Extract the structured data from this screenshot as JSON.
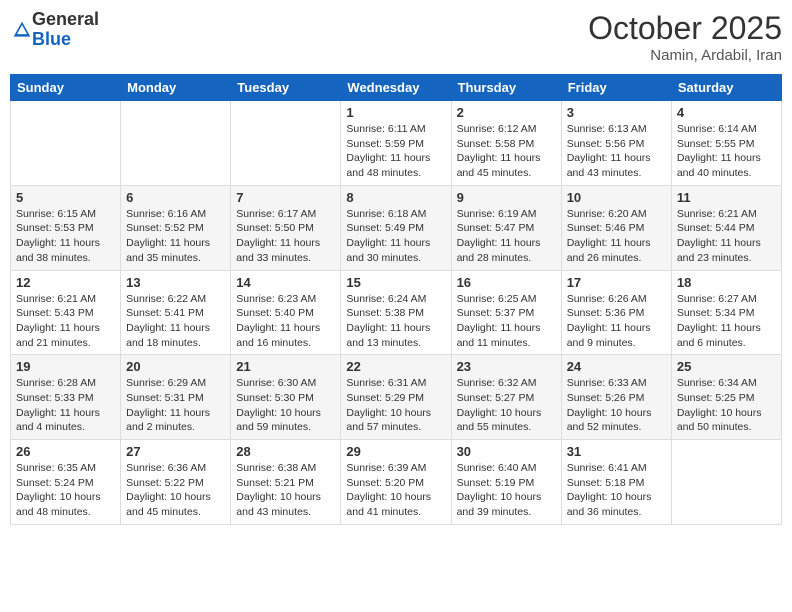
{
  "logo": {
    "general": "General",
    "blue": "Blue"
  },
  "header": {
    "month": "October 2025",
    "location": "Namin, Ardabil, Iran"
  },
  "weekdays": [
    "Sunday",
    "Monday",
    "Tuesday",
    "Wednesday",
    "Thursday",
    "Friday",
    "Saturday"
  ],
  "weeks": [
    [
      null,
      null,
      null,
      {
        "day": "1",
        "sunrise": "6:11 AM",
        "sunset": "5:59 PM",
        "daylight": "11 hours and 48 minutes."
      },
      {
        "day": "2",
        "sunrise": "6:12 AM",
        "sunset": "5:58 PM",
        "daylight": "11 hours and 45 minutes."
      },
      {
        "day": "3",
        "sunrise": "6:13 AM",
        "sunset": "5:56 PM",
        "daylight": "11 hours and 43 minutes."
      },
      {
        "day": "4",
        "sunrise": "6:14 AM",
        "sunset": "5:55 PM",
        "daylight": "11 hours and 40 minutes."
      }
    ],
    [
      {
        "day": "5",
        "sunrise": "6:15 AM",
        "sunset": "5:53 PM",
        "daylight": "11 hours and 38 minutes."
      },
      {
        "day": "6",
        "sunrise": "6:16 AM",
        "sunset": "5:52 PM",
        "daylight": "11 hours and 35 minutes."
      },
      {
        "day": "7",
        "sunrise": "6:17 AM",
        "sunset": "5:50 PM",
        "daylight": "11 hours and 33 minutes."
      },
      {
        "day": "8",
        "sunrise": "6:18 AM",
        "sunset": "5:49 PM",
        "daylight": "11 hours and 30 minutes."
      },
      {
        "day": "9",
        "sunrise": "6:19 AM",
        "sunset": "5:47 PM",
        "daylight": "11 hours and 28 minutes."
      },
      {
        "day": "10",
        "sunrise": "6:20 AM",
        "sunset": "5:46 PM",
        "daylight": "11 hours and 26 minutes."
      },
      {
        "day": "11",
        "sunrise": "6:21 AM",
        "sunset": "5:44 PM",
        "daylight": "11 hours and 23 minutes."
      }
    ],
    [
      {
        "day": "12",
        "sunrise": "6:21 AM",
        "sunset": "5:43 PM",
        "daylight": "11 hours and 21 minutes."
      },
      {
        "day": "13",
        "sunrise": "6:22 AM",
        "sunset": "5:41 PM",
        "daylight": "11 hours and 18 minutes."
      },
      {
        "day": "14",
        "sunrise": "6:23 AM",
        "sunset": "5:40 PM",
        "daylight": "11 hours and 16 minutes."
      },
      {
        "day": "15",
        "sunrise": "6:24 AM",
        "sunset": "5:38 PM",
        "daylight": "11 hours and 13 minutes."
      },
      {
        "day": "16",
        "sunrise": "6:25 AM",
        "sunset": "5:37 PM",
        "daylight": "11 hours and 11 minutes."
      },
      {
        "day": "17",
        "sunrise": "6:26 AM",
        "sunset": "5:36 PM",
        "daylight": "11 hours and 9 minutes."
      },
      {
        "day": "18",
        "sunrise": "6:27 AM",
        "sunset": "5:34 PM",
        "daylight": "11 hours and 6 minutes."
      }
    ],
    [
      {
        "day": "19",
        "sunrise": "6:28 AM",
        "sunset": "5:33 PM",
        "daylight": "11 hours and 4 minutes."
      },
      {
        "day": "20",
        "sunrise": "6:29 AM",
        "sunset": "5:31 PM",
        "daylight": "11 hours and 2 minutes."
      },
      {
        "day": "21",
        "sunrise": "6:30 AM",
        "sunset": "5:30 PM",
        "daylight": "10 hours and 59 minutes."
      },
      {
        "day": "22",
        "sunrise": "6:31 AM",
        "sunset": "5:29 PM",
        "daylight": "10 hours and 57 minutes."
      },
      {
        "day": "23",
        "sunrise": "6:32 AM",
        "sunset": "5:27 PM",
        "daylight": "10 hours and 55 minutes."
      },
      {
        "day": "24",
        "sunrise": "6:33 AM",
        "sunset": "5:26 PM",
        "daylight": "10 hours and 52 minutes."
      },
      {
        "day": "25",
        "sunrise": "6:34 AM",
        "sunset": "5:25 PM",
        "daylight": "10 hours and 50 minutes."
      }
    ],
    [
      {
        "day": "26",
        "sunrise": "6:35 AM",
        "sunset": "5:24 PM",
        "daylight": "10 hours and 48 minutes."
      },
      {
        "day": "27",
        "sunrise": "6:36 AM",
        "sunset": "5:22 PM",
        "daylight": "10 hours and 45 minutes."
      },
      {
        "day": "28",
        "sunrise": "6:38 AM",
        "sunset": "5:21 PM",
        "daylight": "10 hours and 43 minutes."
      },
      {
        "day": "29",
        "sunrise": "6:39 AM",
        "sunset": "5:20 PM",
        "daylight": "10 hours and 41 minutes."
      },
      {
        "day": "30",
        "sunrise": "6:40 AM",
        "sunset": "5:19 PM",
        "daylight": "10 hours and 39 minutes."
      },
      {
        "day": "31",
        "sunrise": "6:41 AM",
        "sunset": "5:18 PM",
        "daylight": "10 hours and 36 minutes."
      },
      null
    ]
  ]
}
